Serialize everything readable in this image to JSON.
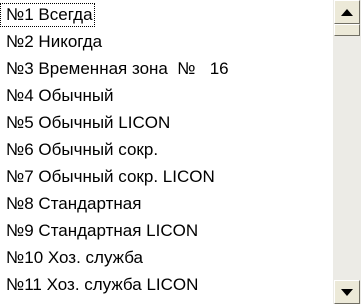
{
  "list": {
    "items": [
      "№1 Всегда",
      "№2 Никогда",
      "№3 Временная зона  №   16",
      "№4 Обычный",
      "№5 Обычный LICON",
      "№6 Обычный сокр.",
      "№7 Обычный сокр. LICON",
      "№8 Стандартная",
      "№9 Стандартная LICON",
      "№10 Хоз. служба",
      "№11 Хоз. служба LICON"
    ],
    "selected_index": 0
  },
  "scrollbar": {
    "up_icon": "arrow-up-icon",
    "down_icon": "arrow-down-icon"
  }
}
